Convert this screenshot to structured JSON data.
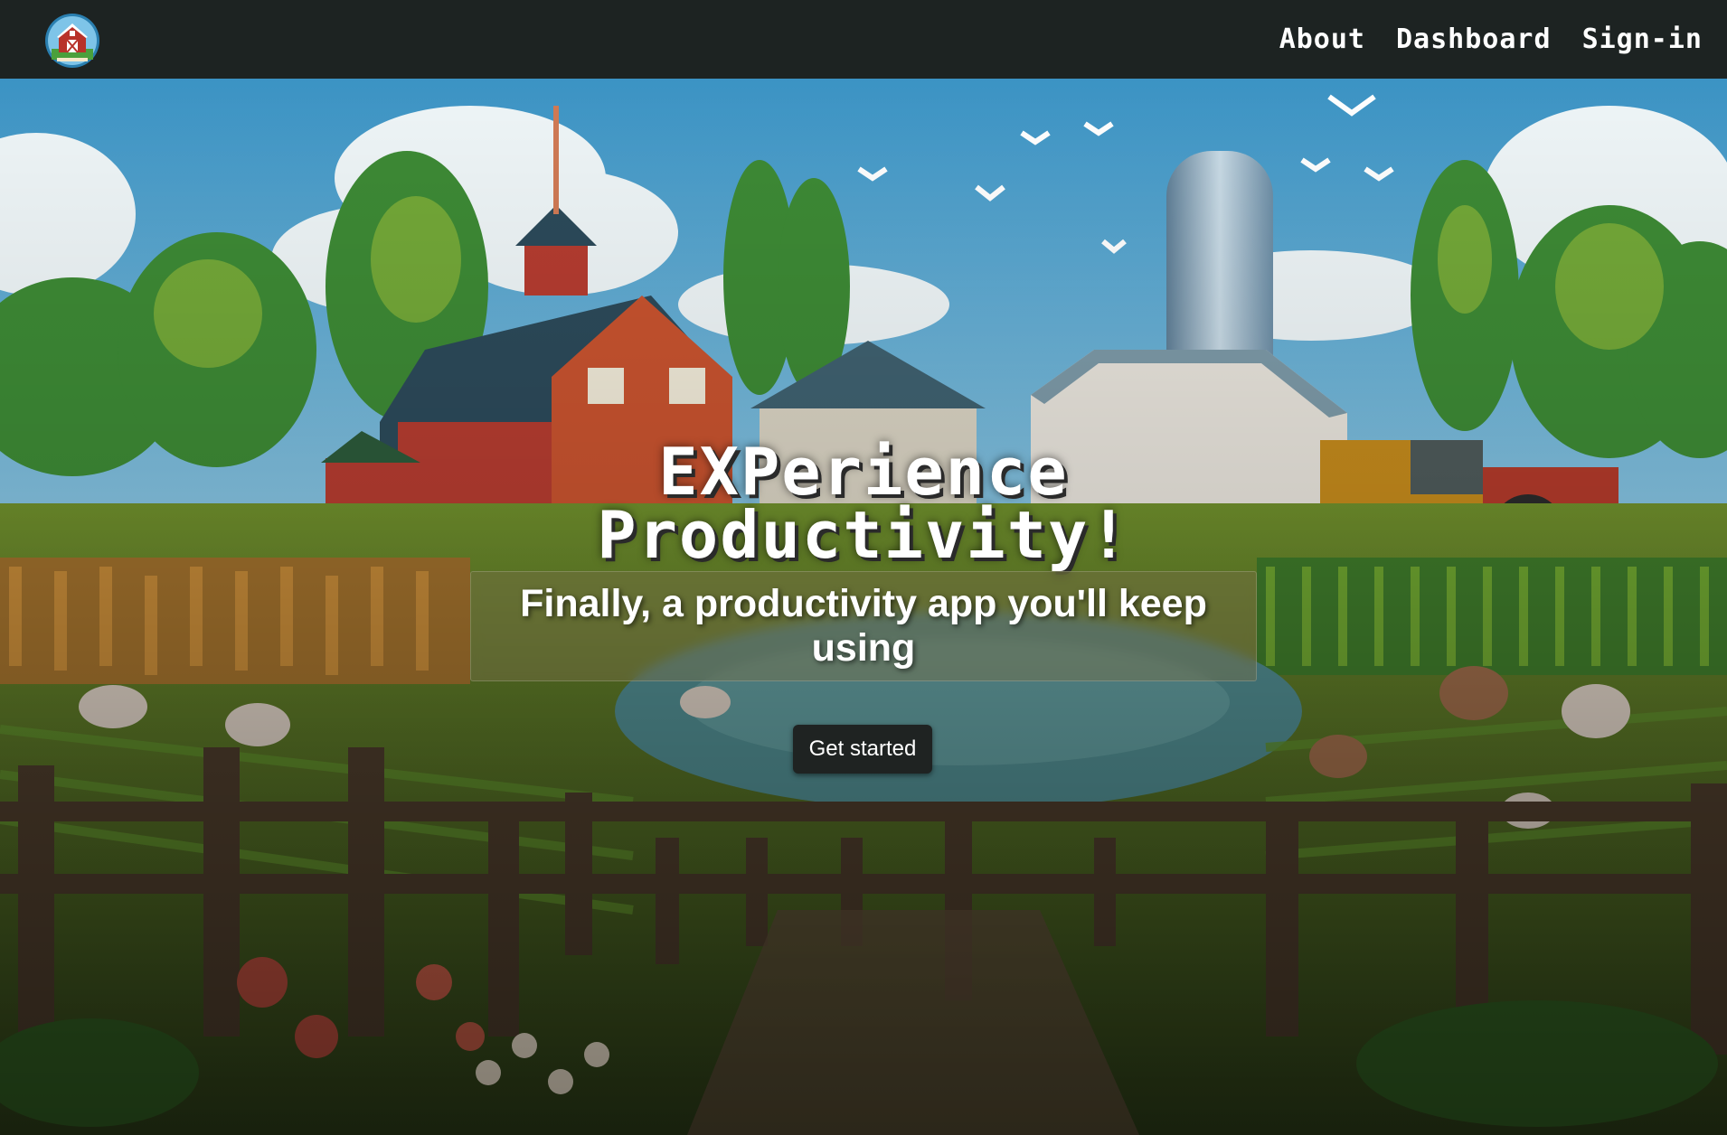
{
  "navbar": {
    "logo_icon": "barn-logo-icon",
    "links": [
      "About",
      "Dashboard",
      "Sign-in"
    ]
  },
  "hero": {
    "headline_line1": "EXPerience",
    "headline_line2": "Productivity!",
    "subtitle": "Finally, a productivity app you'll keep using",
    "cta_label": "Get started",
    "background": "pixel-art-farm-scene"
  },
  "colors": {
    "navbar_bg": "#1d2322",
    "button_bg": "#1f2322",
    "text": "#ffffff"
  }
}
